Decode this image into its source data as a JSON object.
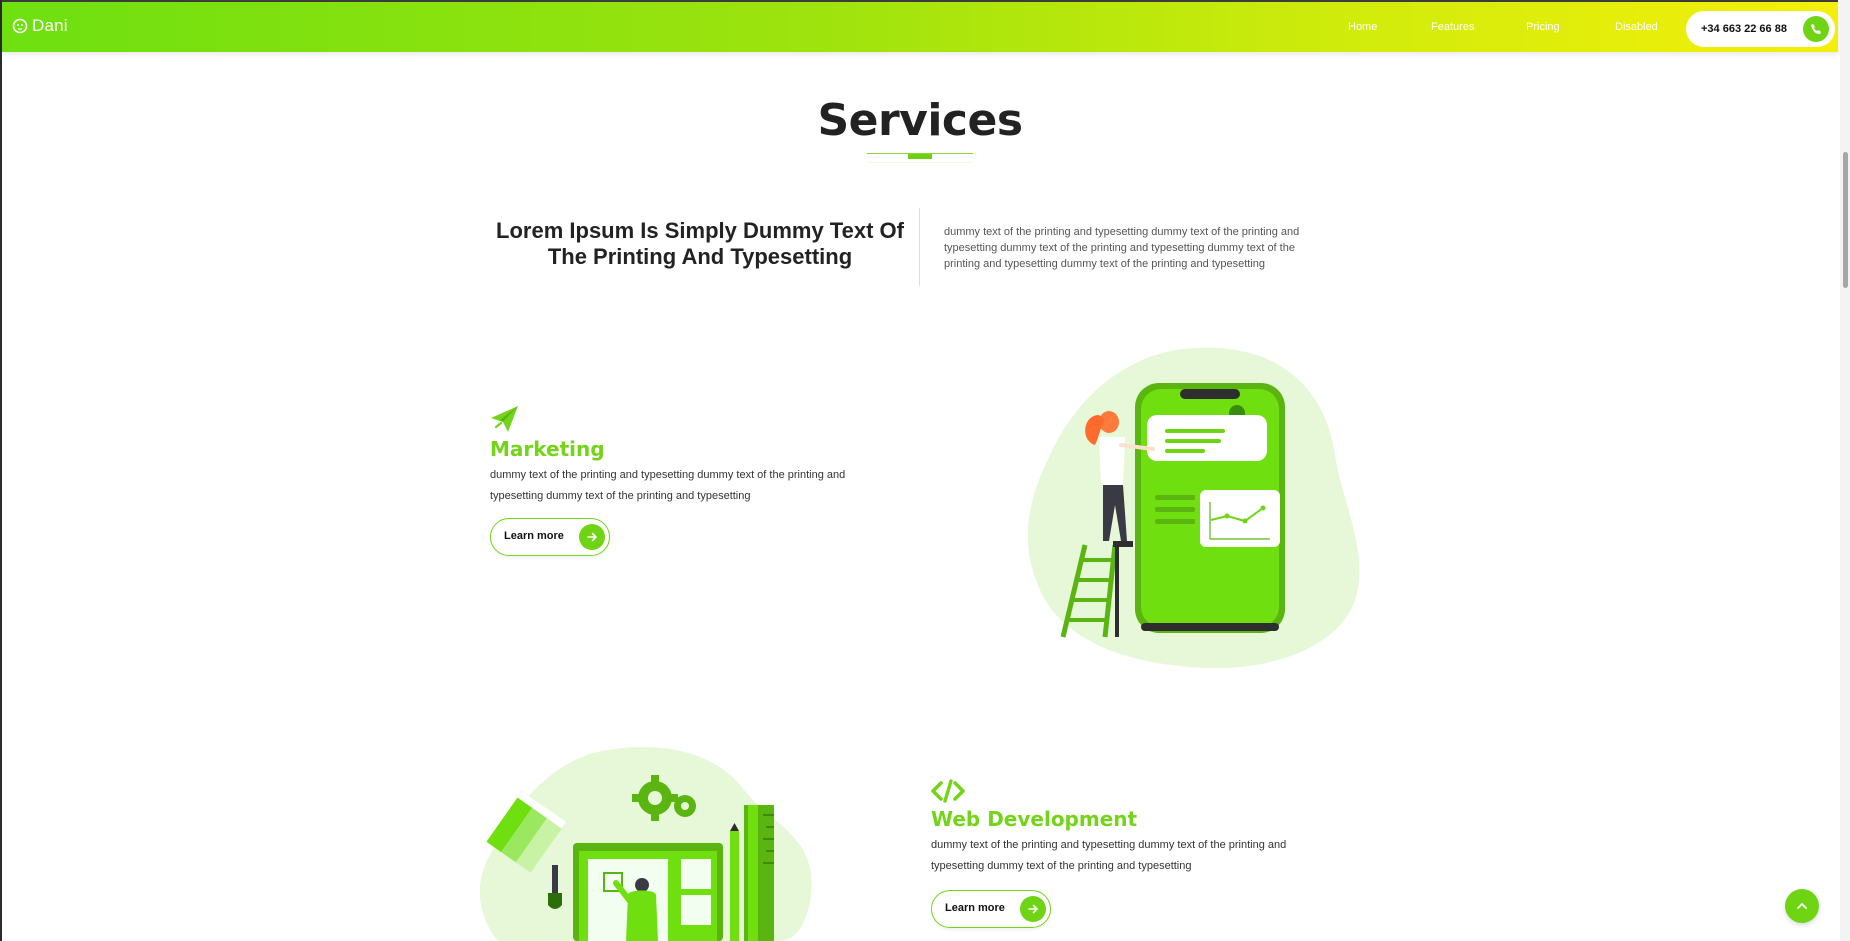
{
  "nav": {
    "brand": "Dani",
    "links": [
      "Home",
      "Features",
      "Pricing",
      "Disabled"
    ],
    "phone": "+34 663 22 66 88"
  },
  "section": {
    "title": "Services",
    "intro_heading": "Lorem Ipsum Is Simply Dummy Text Of The Printing And Typesetting",
    "intro_text": "dummy text of the printing and typesetting dummy text of the printing and typesetting dummy text of the printing and typesetting dummy text of the printing and typesetting dummy text of the printing and typesetting"
  },
  "services": [
    {
      "title": "Marketing",
      "text": "dummy text of the printing and typesetting dummy text of the printing and typesetting dummy text of the printing and typesetting",
      "button": "Learn more",
      "icon": "paper-plane-icon"
    },
    {
      "title": "Web Development",
      "text": "dummy text of the printing and typesetting dummy text of the printing and typesetting dummy text of the printing and typesetting",
      "button": "Learn more",
      "icon": "code-icon"
    }
  ],
  "colors": {
    "accent": "#6fd414",
    "accent_light": "#e6f9d6",
    "nav_gradient_start": "#6ee010",
    "nav_gradient_end": "#f4ef0a"
  }
}
